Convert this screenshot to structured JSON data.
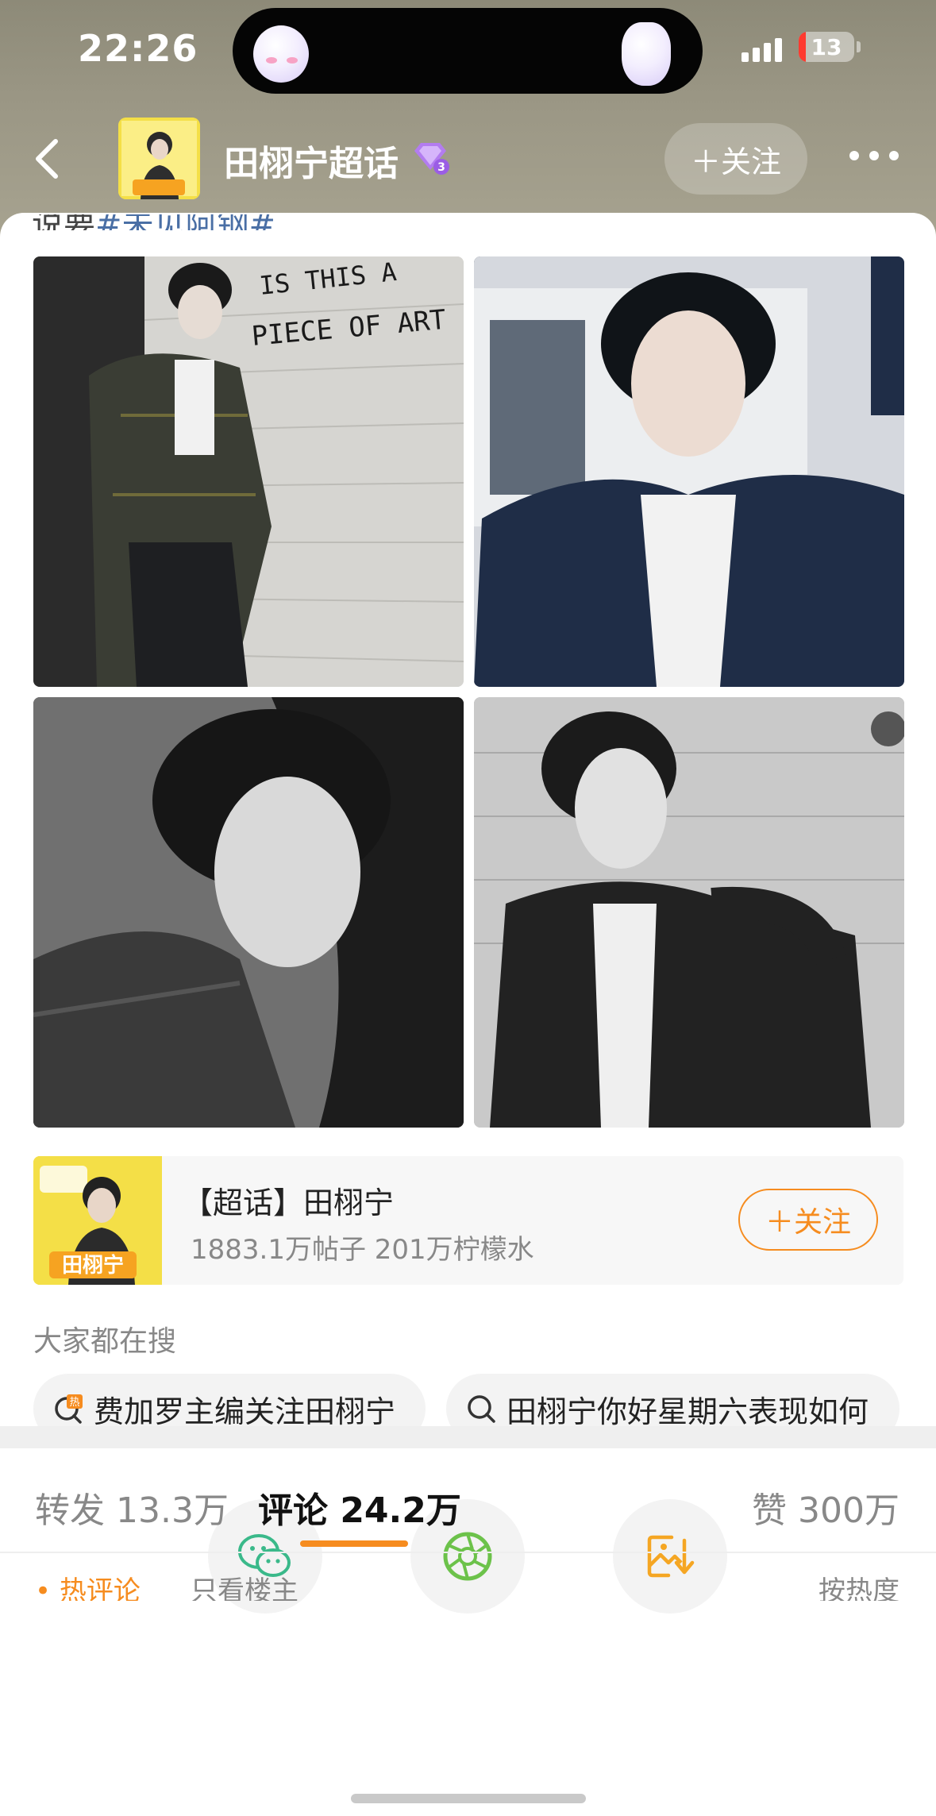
{
  "status_bar": {
    "time": "22:26",
    "battery_level": "13",
    "battery_fraction": 0.13
  },
  "header": {
    "title": "田栩宁超话",
    "follow_label": "＋关注",
    "back_icon": "chevron-left-icon",
    "more_icon": "more-horizontal-icon",
    "badge_icon": "level-diamond-icon",
    "badge_level": "3"
  },
  "post": {
    "peek_text_prefix": "说要",
    "peek_text_hashtag": "#未见阿钢#"
  },
  "photo_texts": {
    "wall_line1": "IS THIS A",
    "wall_line2": "PIECE OF ART"
  },
  "supertopic": {
    "name": "【超话】田栩宁",
    "stats": "1883.1万帖子 201万柠檬水",
    "follow_label": "＋关注",
    "thumb_label": "田栩宁"
  },
  "search": {
    "heading": "大家都在搜",
    "chips": [
      {
        "text": "费加罗主编关注田栩宁",
        "icon": "hot-search-icon"
      },
      {
        "text": "田栩宁你好星期六表现如何",
        "icon": "search-icon"
      }
    ]
  },
  "share": {
    "items": [
      {
        "icon": "wechat-icon",
        "color": "#3ab98a"
      },
      {
        "icon": "moments-icon",
        "color": "#6cc24a"
      },
      {
        "icon": "save-image-icon",
        "color": "#f5a623"
      }
    ]
  },
  "tabs": {
    "repost": "转发 13.3万",
    "comments": "评论 24.2万",
    "likes": "赞 300万",
    "active": "comments"
  },
  "sub_bar": {
    "left": "• 热评论",
    "mid": "只看楼主",
    "right": "按热度"
  },
  "colors": {
    "accent": "#f68c1f",
    "hashtag": "#4a6fa5",
    "battery_low": "#ff3b30"
  }
}
